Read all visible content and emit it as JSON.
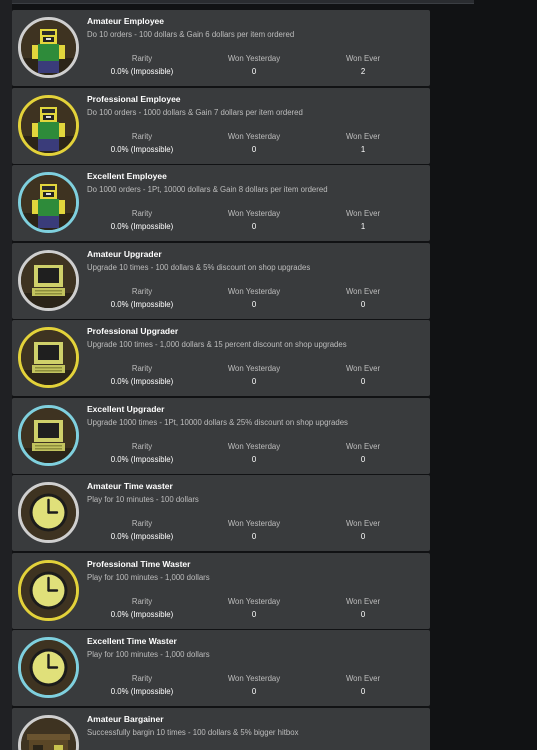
{
  "labels": {
    "rarity": "Rarity",
    "won_yesterday": "Won Yesterday",
    "won_ever": "Won Ever"
  },
  "colors": {
    "ring_silver": "#cfcfcf",
    "ring_gold": "#e3d23a",
    "ring_cyan": "#7fd0de",
    "card_bg": "#393b3d",
    "page_bg": "#111214"
  },
  "badges": [
    {
      "title": "Amateur Employee",
      "description": "Do 10 orders - 100 dollars & Gain 6 dollars per item ordered",
      "rarity": "0.0% (Impossible)",
      "won_yesterday": "0",
      "won_ever": "2",
      "icon": "employee-icon",
      "tier": "silver"
    },
    {
      "title": "Professional Employee",
      "description": "Do 100 orders - 1000 dollars & Gain 7 dollars per item ordered",
      "rarity": "0.0% (Impossible)",
      "won_yesterday": "0",
      "won_ever": "1",
      "icon": "employee-icon",
      "tier": "gold"
    },
    {
      "title": "Excellent Employee",
      "description": "Do 1000 orders - 1Pt, 10000 dollars & Gain 8 dollars per item ordered",
      "rarity": "0.0% (Impossible)",
      "won_yesterday": "0",
      "won_ever": "1",
      "icon": "employee-icon",
      "tier": "cyan"
    },
    {
      "title": "Amateur Upgrader",
      "description": "Upgrade 10 times - 100 dollars & 5% discount on shop upgrades",
      "rarity": "0.0% (Impossible)",
      "won_yesterday": "0",
      "won_ever": "0",
      "icon": "computer-icon",
      "tier": "silver"
    },
    {
      "title": "Professional Upgrader",
      "description": "Upgrade 100 times - 1,000 dollars & 15 percent discount on shop upgrades",
      "rarity": "0.0% (Impossible)",
      "won_yesterday": "0",
      "won_ever": "0",
      "icon": "computer-icon",
      "tier": "gold"
    },
    {
      "title": "Excellent Upgrader",
      "description": "Upgrade 1000 times - 1Pt, 10000 dollars & 25% discount on shop upgrades",
      "rarity": "0.0% (Impossible)",
      "won_yesterday": "0",
      "won_ever": "0",
      "icon": "computer-icon",
      "tier": "cyan"
    },
    {
      "title": "Amateur Time waster",
      "description": "Play for 10 minutes - 100 dollars",
      "rarity": "0.0% (Impossible)",
      "won_yesterday": "0",
      "won_ever": "0",
      "icon": "clock-icon",
      "tier": "silver"
    },
    {
      "title": "Professional Time Waster",
      "description": "Play for 100 minutes - 1,000 dollars",
      "rarity": "0.0% (Impossible)",
      "won_yesterday": "0",
      "won_ever": "0",
      "icon": "clock-icon",
      "tier": "gold"
    },
    {
      "title": "Excellent Time Waster",
      "description": "Play for 100 minutes - 1,000 dollars",
      "rarity": "0.0% (Impossible)",
      "won_yesterday": "0",
      "won_ever": "0",
      "icon": "clock-icon",
      "tier": "cyan"
    },
    {
      "title": "Amateur Bargainer",
      "description": "Successfully bargin 10 times - 100 dollars & 5% bigger hitbox",
      "rarity": "",
      "won_yesterday": "",
      "won_ever": "",
      "icon": "shop-icon",
      "tier": "silver"
    }
  ]
}
